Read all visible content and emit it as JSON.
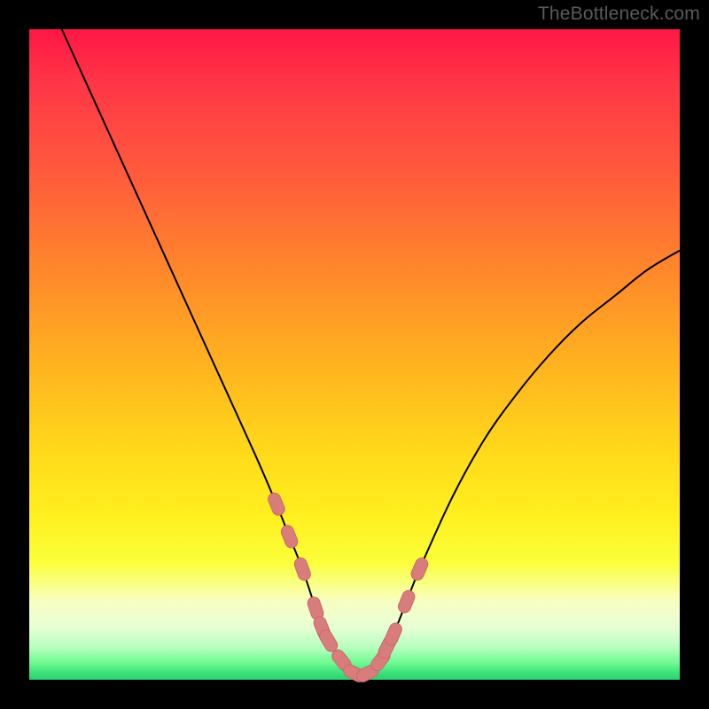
{
  "watermark": "TheBottleneck.com",
  "colors": {
    "frame": "#000000",
    "curve_stroke": "#000000",
    "marker_fill": "#d97c7c",
    "marker_stroke": "#c96a6a"
  },
  "chart_data": {
    "type": "line",
    "title": "",
    "xlabel": "",
    "ylabel": "",
    "xlim": [
      0,
      100
    ],
    "ylim": [
      0,
      100
    ],
    "grid": false,
    "series": [
      {
        "name": "bottleneck-curve",
        "x": [
          5,
          10,
          15,
          20,
          25,
          30,
          35,
          38,
          40,
          42,
          44,
          45,
          46,
          48,
          50,
          52,
          54,
          55,
          56,
          58,
          60,
          65,
          70,
          75,
          80,
          85,
          90,
          95,
          100
        ],
        "y": [
          100,
          89,
          78,
          67,
          56,
          45,
          34,
          27,
          22,
          17,
          11,
          8,
          6,
          3,
          1,
          1,
          3,
          5,
          7,
          12,
          17,
          28,
          37,
          44,
          50,
          55,
          59,
          63,
          66
        ]
      }
    ],
    "markers": {
      "name": "highlighted-points",
      "x": [
        38,
        40,
        42,
        44,
        45,
        46,
        48,
        50,
        52,
        54,
        55,
        56,
        58,
        60
      ],
      "y": [
        27,
        22,
        17,
        11,
        8,
        6,
        3,
        1,
        1,
        3,
        5,
        7,
        12,
        17
      ]
    }
  }
}
